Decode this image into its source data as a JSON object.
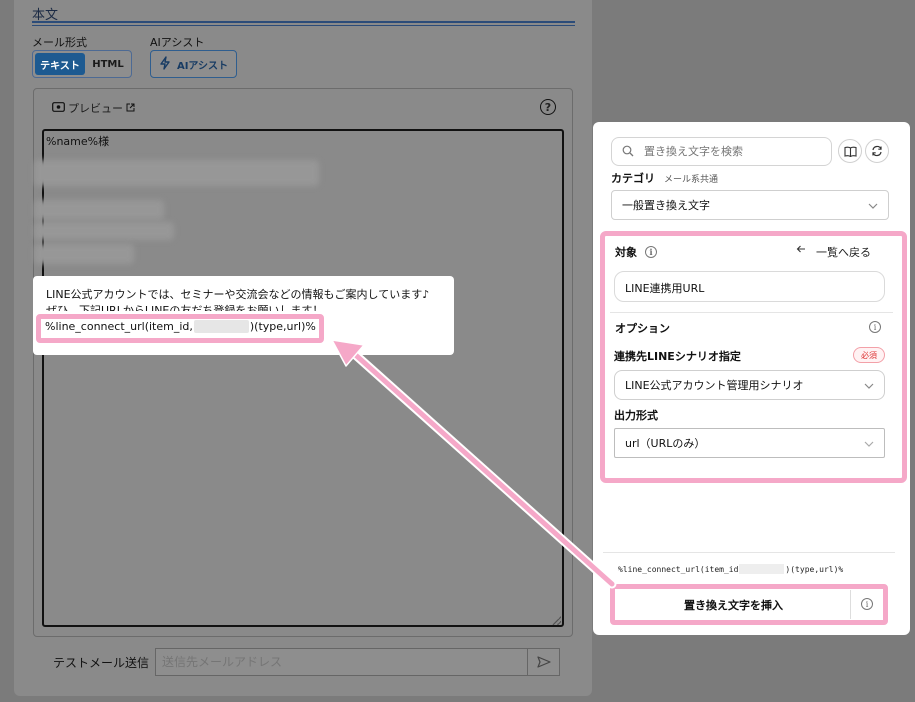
{
  "editor": {
    "section_title": "本文",
    "mail_format_label": "メール形式",
    "format_text": "テキスト",
    "format_html": "HTML",
    "ai_assist_label": "AIアシスト",
    "ai_assist_button": "AIアシスト",
    "preview_link": "プレビュー",
    "help": "?",
    "first_line": "%name%様",
    "test_send_label": "テストメール送信",
    "test_send_placeholder": "送信先メールアドレス"
  },
  "snippet": {
    "line1": "LINE公式アカウントでは、セミナーや交流会などの情報もご案内しています♪",
    "line2": "ぜひ、下記URLからLINEの友だち登録をお願いします！",
    "code_prefix": "%line_connect_url(item_id,",
    "code_suffix": ")(type,url)%"
  },
  "panel": {
    "search_placeholder": "置き換え文字を検索",
    "category_label": "カテゴリ",
    "category_sub": "メール系共通",
    "category_value": "一般置き換え文字",
    "target_label": "対象",
    "back_link": "一覧へ戻る",
    "target_value": "LINE連携用URL",
    "options_label": "オプション",
    "scenario_label": "連携先LINEシナリオ指定",
    "required_badge": "必須",
    "scenario_value": "LINE公式アカウント管理用シナリオ",
    "output_label": "出力形式",
    "output_value": "url（URLのみ）",
    "code_preview_prefix": "%line_connect_url(item_id",
    "code_preview_suffix": ")(type,url)%",
    "insert_button": "置き換え文字を挿入"
  },
  "colors": {
    "highlight_pink": "#f5a8c8",
    "overlay_gray": "#7b7b7b",
    "brand_blue": "#1d5a91"
  },
  "icons": [
    "eye-icon",
    "external-link-icon",
    "lightning-icon",
    "search-icon",
    "book-icon",
    "refresh-icon",
    "info-icon",
    "arrow-left-icon",
    "chevron-down-icon",
    "send-icon"
  ]
}
